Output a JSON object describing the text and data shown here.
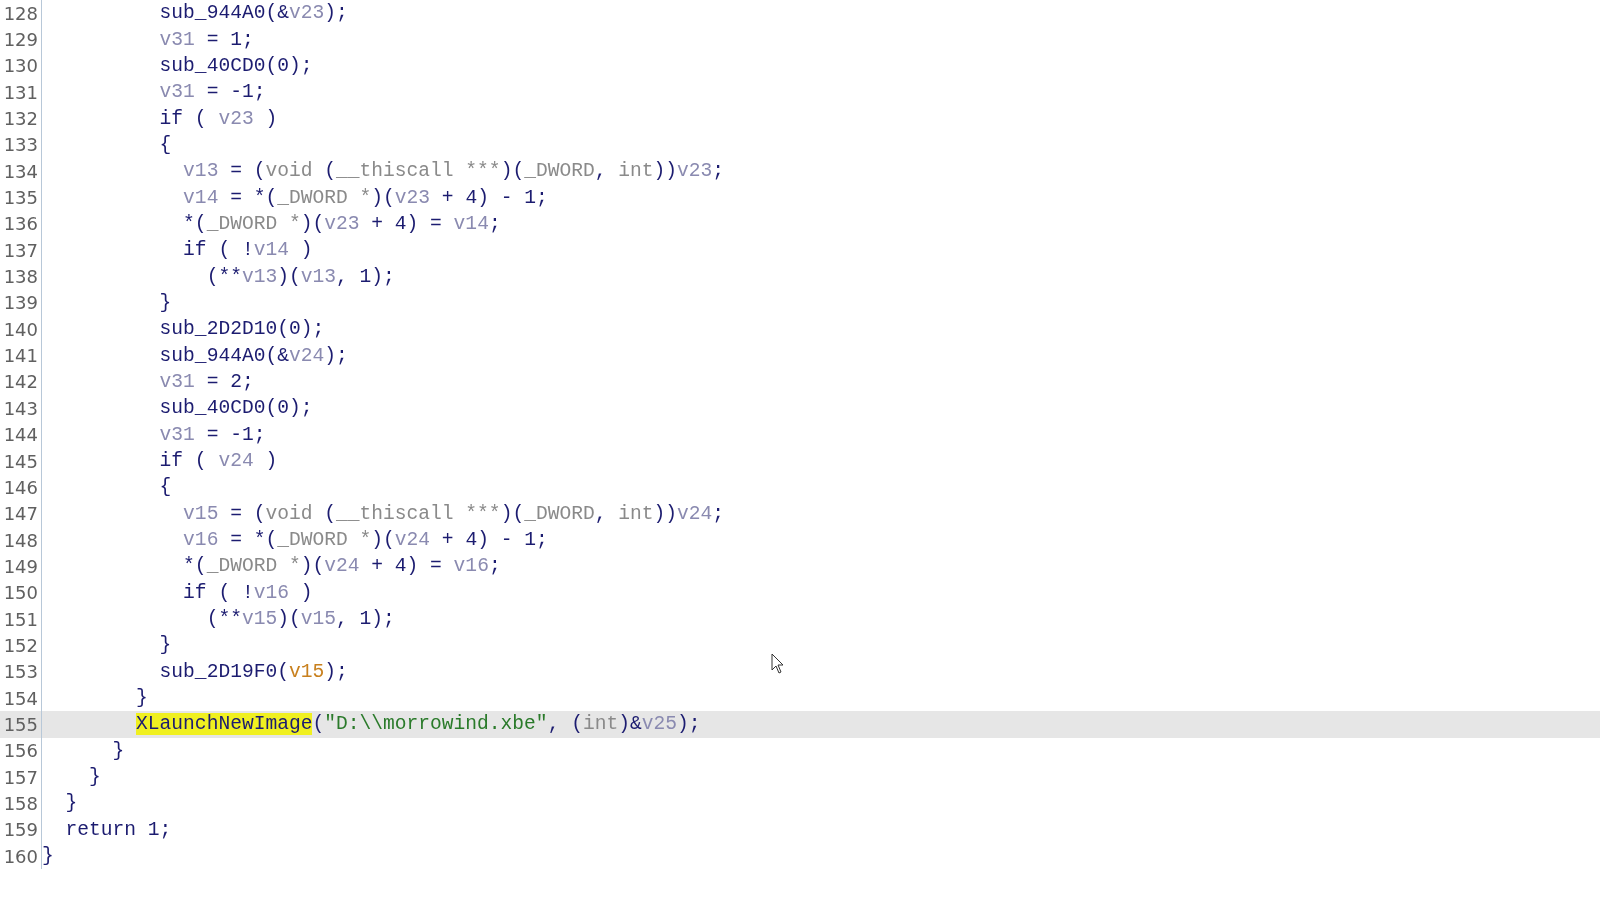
{
  "code_view": {
    "lines": [
      {
        "number": "128",
        "current": false,
        "tokens": [
          {
            "kind": "code",
            "text": "          sub_944A0(&"
          },
          {
            "kind": "var",
            "text": "v23"
          },
          {
            "kind": "code",
            "text": ");"
          }
        ]
      },
      {
        "number": "129",
        "current": false,
        "tokens": [
          {
            "kind": "var",
            "text": "          v31"
          },
          {
            "kind": "code",
            "text": " = 1;"
          }
        ]
      },
      {
        "number": "130",
        "current": false,
        "tokens": [
          {
            "kind": "code",
            "text": "          sub_40CD0(0);"
          }
        ]
      },
      {
        "number": "131",
        "current": false,
        "tokens": [
          {
            "kind": "var",
            "text": "          v31"
          },
          {
            "kind": "code",
            "text": " = -1;"
          }
        ]
      },
      {
        "number": "132",
        "current": false,
        "tokens": [
          {
            "kind": "code",
            "text": "          if ( "
          },
          {
            "kind": "var",
            "text": "v23"
          },
          {
            "kind": "code",
            "text": " )"
          }
        ]
      },
      {
        "number": "133",
        "current": false,
        "tokens": [
          {
            "kind": "code",
            "text": "          {"
          }
        ]
      },
      {
        "number": "134",
        "current": false,
        "tokens": [
          {
            "kind": "var",
            "text": "            v13"
          },
          {
            "kind": "code",
            "text": " = ("
          },
          {
            "kind": "type",
            "text": "void"
          },
          {
            "kind": "code",
            "text": " ("
          },
          {
            "kind": "type",
            "text": "__thiscall ***"
          },
          {
            "kind": "code",
            "text": ")("
          },
          {
            "kind": "type",
            "text": "_DWORD"
          },
          {
            "kind": "code",
            "text": ", "
          },
          {
            "kind": "type",
            "text": "int"
          },
          {
            "kind": "code",
            "text": "))"
          },
          {
            "kind": "var",
            "text": "v23"
          },
          {
            "kind": "code",
            "text": ";"
          }
        ]
      },
      {
        "number": "135",
        "current": false,
        "tokens": [
          {
            "kind": "var",
            "text": "            v14"
          },
          {
            "kind": "code",
            "text": " = *("
          },
          {
            "kind": "type",
            "text": "_DWORD *"
          },
          {
            "kind": "code",
            "text": ")("
          },
          {
            "kind": "var",
            "text": "v23"
          },
          {
            "kind": "code",
            "text": " + 4) - 1;"
          }
        ]
      },
      {
        "number": "136",
        "current": false,
        "tokens": [
          {
            "kind": "code",
            "text": "            *("
          },
          {
            "kind": "type",
            "text": "_DWORD *"
          },
          {
            "kind": "code",
            "text": ")("
          },
          {
            "kind": "var",
            "text": "v23"
          },
          {
            "kind": "code",
            "text": " + 4) = "
          },
          {
            "kind": "var",
            "text": "v14"
          },
          {
            "kind": "code",
            "text": ";"
          }
        ]
      },
      {
        "number": "137",
        "current": false,
        "tokens": [
          {
            "kind": "code",
            "text": "            if ( !"
          },
          {
            "kind": "var",
            "text": "v14"
          },
          {
            "kind": "code",
            "text": " )"
          }
        ]
      },
      {
        "number": "138",
        "current": false,
        "tokens": [
          {
            "kind": "code",
            "text": "              (**"
          },
          {
            "kind": "var",
            "text": "v13"
          },
          {
            "kind": "code",
            "text": ")("
          },
          {
            "kind": "var",
            "text": "v13"
          },
          {
            "kind": "code",
            "text": ", 1);"
          }
        ]
      },
      {
        "number": "139",
        "current": false,
        "tokens": [
          {
            "kind": "code",
            "text": "          }"
          }
        ]
      },
      {
        "number": "140",
        "current": false,
        "tokens": [
          {
            "kind": "code",
            "text": "          sub_2D2D10(0);"
          }
        ]
      },
      {
        "number": "141",
        "current": false,
        "tokens": [
          {
            "kind": "code",
            "text": "          sub_944A0(&"
          },
          {
            "kind": "var",
            "text": "v24"
          },
          {
            "kind": "code",
            "text": ");"
          }
        ]
      },
      {
        "number": "142",
        "current": false,
        "tokens": [
          {
            "kind": "var",
            "text": "          v31"
          },
          {
            "kind": "code",
            "text": " = 2;"
          }
        ]
      },
      {
        "number": "143",
        "current": false,
        "tokens": [
          {
            "kind": "code",
            "text": "          sub_40CD0(0);"
          }
        ]
      },
      {
        "number": "144",
        "current": false,
        "tokens": [
          {
            "kind": "var",
            "text": "          v31"
          },
          {
            "kind": "code",
            "text": " = -1;"
          }
        ]
      },
      {
        "number": "145",
        "current": false,
        "tokens": [
          {
            "kind": "code",
            "text": "          if ( "
          },
          {
            "kind": "var",
            "text": "v24"
          },
          {
            "kind": "code",
            "text": " )"
          }
        ]
      },
      {
        "number": "146",
        "current": false,
        "tokens": [
          {
            "kind": "code",
            "text": "          {"
          }
        ]
      },
      {
        "number": "147",
        "current": false,
        "tokens": [
          {
            "kind": "var",
            "text": "            v15"
          },
          {
            "kind": "code",
            "text": " = ("
          },
          {
            "kind": "type",
            "text": "void"
          },
          {
            "kind": "code",
            "text": " ("
          },
          {
            "kind": "type",
            "text": "__thiscall ***"
          },
          {
            "kind": "code",
            "text": ")("
          },
          {
            "kind": "type",
            "text": "_DWORD"
          },
          {
            "kind": "code",
            "text": ", "
          },
          {
            "kind": "type",
            "text": "int"
          },
          {
            "kind": "code",
            "text": "))"
          },
          {
            "kind": "var",
            "text": "v24"
          },
          {
            "kind": "code",
            "text": ";"
          }
        ]
      },
      {
        "number": "148",
        "current": false,
        "tokens": [
          {
            "kind": "var",
            "text": "            v16"
          },
          {
            "kind": "code",
            "text": " = *("
          },
          {
            "kind": "type",
            "text": "_DWORD *"
          },
          {
            "kind": "code",
            "text": ")("
          },
          {
            "kind": "var",
            "text": "v24"
          },
          {
            "kind": "code",
            "text": " + 4) - 1;"
          }
        ]
      },
      {
        "number": "149",
        "current": false,
        "tokens": [
          {
            "kind": "code",
            "text": "            *("
          },
          {
            "kind": "type",
            "text": "_DWORD *"
          },
          {
            "kind": "code",
            "text": ")("
          },
          {
            "kind": "var",
            "text": "v24"
          },
          {
            "kind": "code",
            "text": " + 4) = "
          },
          {
            "kind": "var",
            "text": "v16"
          },
          {
            "kind": "code",
            "text": ";"
          }
        ]
      },
      {
        "number": "150",
        "current": false,
        "tokens": [
          {
            "kind": "code",
            "text": "            if ( !"
          },
          {
            "kind": "var",
            "text": "v16"
          },
          {
            "kind": "code",
            "text": " )"
          }
        ]
      },
      {
        "number": "151",
        "current": false,
        "tokens": [
          {
            "kind": "code",
            "text": "              (**"
          },
          {
            "kind": "var",
            "text": "v15"
          },
          {
            "kind": "code",
            "text": ")("
          },
          {
            "kind": "var",
            "text": "v15"
          },
          {
            "kind": "code",
            "text": ", 1);"
          }
        ]
      },
      {
        "number": "152",
        "current": false,
        "tokens": [
          {
            "kind": "code",
            "text": "          }"
          }
        ]
      },
      {
        "number": "153",
        "current": false,
        "tokens": [
          {
            "kind": "code",
            "text": "          sub_2D19F0("
          },
          {
            "kind": "global",
            "text": "v15"
          },
          {
            "kind": "code",
            "text": ");"
          }
        ]
      },
      {
        "number": "154",
        "current": false,
        "tokens": [
          {
            "kind": "code",
            "text": "        }"
          }
        ]
      },
      {
        "number": "155",
        "current": true,
        "tokens": [
          {
            "kind": "highlight",
            "text": "        XLaunchNewImage"
          },
          {
            "kind": "code",
            "text": "("
          },
          {
            "kind": "string",
            "text": "\"D:\\\\morrowind.xbe\""
          },
          {
            "kind": "code",
            "text": ", ("
          },
          {
            "kind": "type",
            "text": "int"
          },
          {
            "kind": "code",
            "text": ")&"
          },
          {
            "kind": "var",
            "text": "v25"
          },
          {
            "kind": "code",
            "text": ");"
          }
        ]
      },
      {
        "number": "156",
        "current": false,
        "tokens": [
          {
            "kind": "code",
            "text": "      }"
          }
        ]
      },
      {
        "number": "157",
        "current": false,
        "tokens": [
          {
            "kind": "code",
            "text": "    }"
          }
        ]
      },
      {
        "number": "158",
        "current": false,
        "tokens": [
          {
            "kind": "code",
            "text": "  }"
          }
        ]
      },
      {
        "number": "159",
        "current": false,
        "tokens": [
          {
            "kind": "code",
            "text": "  return 1;"
          }
        ]
      },
      {
        "number": "160",
        "current": false,
        "tokens": [
          {
            "kind": "code",
            "text": "}"
          }
        ]
      }
    ]
  }
}
